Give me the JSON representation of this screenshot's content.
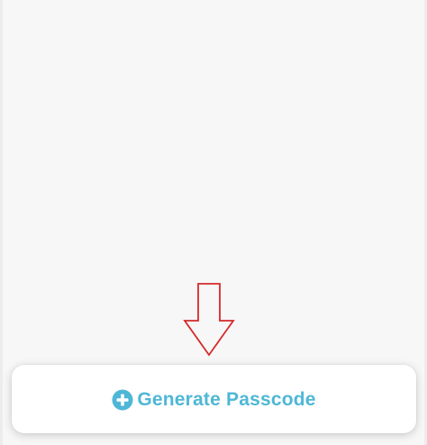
{
  "colors": {
    "background": "#f7f7f7",
    "card": "#ffffff",
    "accent": "#4fb7d6",
    "annotation_arrow": "#d42a2a"
  },
  "annotation": {
    "icon": "down-arrow-outline",
    "direction": "down"
  },
  "action": {
    "icon": "plus-circle-icon",
    "label": "Generate Passcode"
  }
}
